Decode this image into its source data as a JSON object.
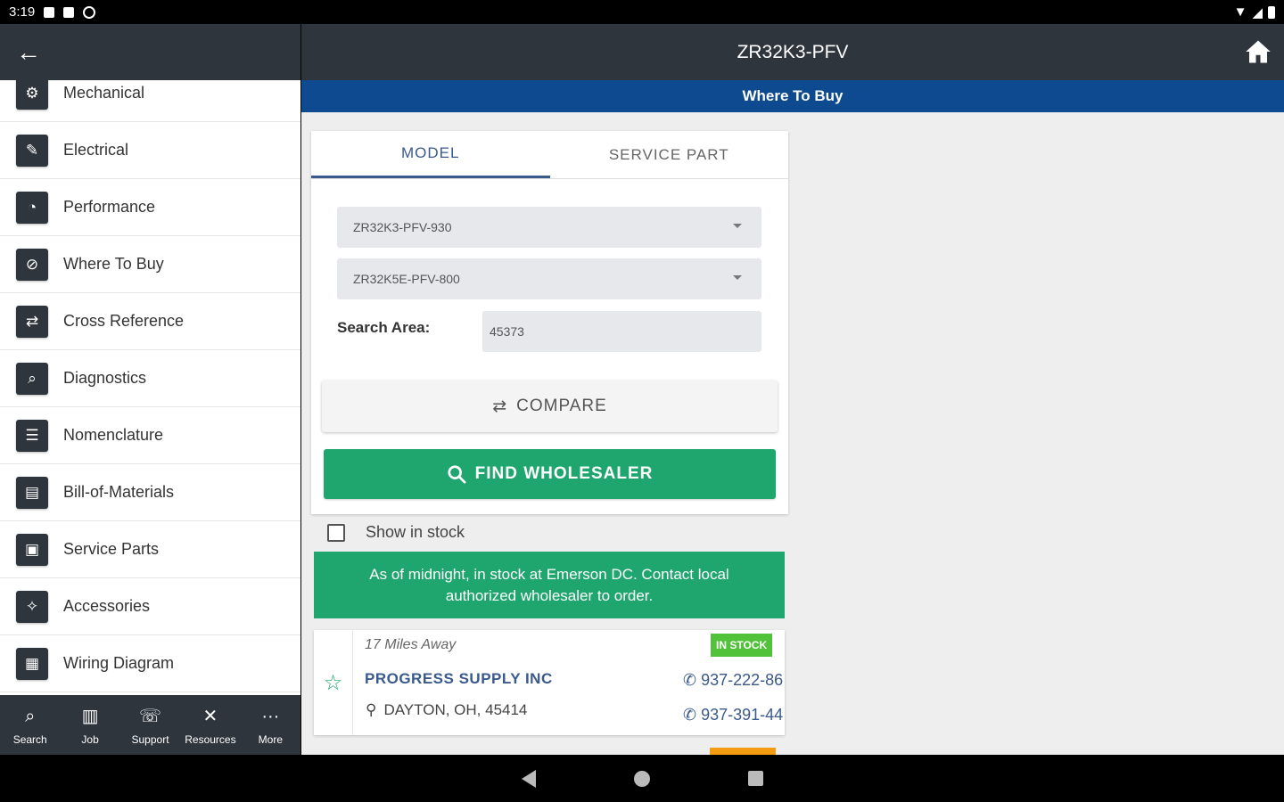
{
  "status_bar": {
    "time": "3:19"
  },
  "drawer": {
    "items": [
      {
        "label": "Mechanical",
        "icon": "gear-icon",
        "glyph": "⚙"
      },
      {
        "label": "Electrical",
        "icon": "screwdriver-icon",
        "glyph": "✎"
      },
      {
        "label": "Performance",
        "icon": "gauge-icon",
        "glyph": "◔"
      },
      {
        "label": "Where To Buy",
        "icon": "compass-icon",
        "glyph": "⊘"
      },
      {
        "label": "Cross Reference",
        "icon": "cross-reference-icon",
        "glyph": "⇄"
      },
      {
        "label": "Diagnostics",
        "icon": "magnifier-icon",
        "glyph": "⌕"
      },
      {
        "label": "Nomenclature",
        "icon": "list-icon",
        "glyph": "☰"
      },
      {
        "label": "Bill-of-Materials",
        "icon": "document-icon",
        "glyph": "▤"
      },
      {
        "label": "Service Parts",
        "icon": "service-parts-icon",
        "glyph": "▣"
      },
      {
        "label": "Accessories",
        "icon": "accessories-icon",
        "glyph": "✧"
      },
      {
        "label": "Wiring Diagram",
        "icon": "wiring-diagram-icon",
        "glyph": "▦"
      }
    ]
  },
  "bottom_nav": [
    {
      "label": "Search",
      "icon": "search-icon",
      "glyph": "⌕"
    },
    {
      "label": "Job",
      "icon": "job-icon",
      "glyph": "▥"
    },
    {
      "label": "Support",
      "icon": "support-icon",
      "glyph": "☏"
    },
    {
      "label": "Resources",
      "icon": "tools-icon",
      "glyph": "✕"
    },
    {
      "label": "More",
      "icon": "more-icon",
      "glyph": "···"
    }
  ],
  "header": {
    "title": "ZR32K3-PFV",
    "subtitle": "Where To Buy"
  },
  "tabs": [
    {
      "label": "MODEL",
      "active": true
    },
    {
      "label": "SERVICE PART",
      "active": false
    }
  ],
  "form": {
    "model_select_1": "ZR32K3-PFV-930",
    "model_select_2": "ZR32K5E-PFV-800",
    "search_area_label": "Search Area:",
    "search_area_value": "45373",
    "compare_label": "COMPARE",
    "find_label": "FIND WHOLESALER"
  },
  "filter": {
    "show_in_stock_label": "Show in stock",
    "checked": false
  },
  "banner": "As of midnight, in stock at Emerson DC. Contact local authorized wholesaler to order.",
  "results": [
    {
      "distance": "17 Miles Away",
      "stock_badge": "IN STOCK",
      "name": "PROGRESS SUPPLY INC",
      "address": "DAYTON, OH, 45414",
      "phone_1": "937-222-86",
      "phone_2": "937-391-44"
    }
  ],
  "colors": {
    "appbar": "#2e353d",
    "subbar": "#0d4a8f",
    "accent_green": "#1ea66e",
    "badge_green": "#52c23a",
    "link_blue": "#3a5a8c"
  }
}
